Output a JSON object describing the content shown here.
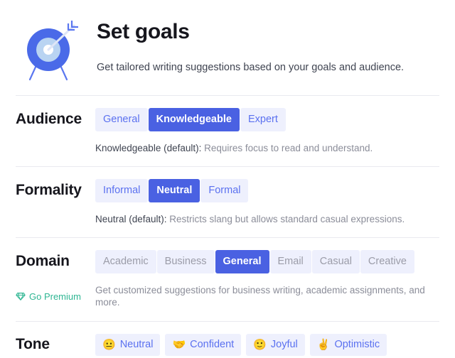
{
  "header": {
    "icon_name": "target-with-arrow-icon",
    "title": "Set goals",
    "subtitle": "Get tailored writing suggestions based on your goals and audience."
  },
  "colors": {
    "accent_selected": "#4a61e2",
    "chip_bg": "#eef0fd",
    "chip_text": "#5b71f0",
    "chip_disabled_text": "#9b9ca8",
    "premium_green": "#2fb693",
    "heading": "#16161d",
    "body_text": "#3f4451",
    "muted_text": "#8b8d99",
    "divider": "#e9eaef"
  },
  "sections": [
    {
      "id": "audience",
      "label": "Audience",
      "options": [
        {
          "label": "General",
          "selected": false,
          "disabled": false
        },
        {
          "label": "Knowledgeable",
          "selected": true,
          "disabled": false
        },
        {
          "label": "Expert",
          "selected": false,
          "disabled": false
        }
      ],
      "description_strong": "Knowledgeable (default):",
      "description_rest": " Requires focus to read and understand."
    },
    {
      "id": "formality",
      "label": "Formality",
      "options": [
        {
          "label": "Informal",
          "selected": false,
          "disabled": false
        },
        {
          "label": "Neutral",
          "selected": true,
          "disabled": false
        },
        {
          "label": "Formal",
          "selected": false,
          "disabled": false
        }
      ],
      "description_strong": "Neutral (default):",
      "description_rest": " Restricts slang but allows standard casual expressions."
    },
    {
      "id": "domain",
      "label": "Domain",
      "options": [
        {
          "label": "Academic",
          "selected": false,
          "disabled": true
        },
        {
          "label": "Business",
          "selected": false,
          "disabled": true
        },
        {
          "label": "General",
          "selected": true,
          "disabled": false
        },
        {
          "label": "Email",
          "selected": false,
          "disabled": true
        },
        {
          "label": "Casual",
          "selected": false,
          "disabled": true
        },
        {
          "label": "Creative",
          "selected": false,
          "disabled": true
        }
      ],
      "premium_label": "Go Premium",
      "premium_icon_name": "gem-icon",
      "description_rest": "Get customized suggestions for business writing, academic assignments, and more."
    },
    {
      "id": "tone",
      "label": "Tone",
      "options": [
        {
          "label": "Neutral",
          "emoji": "😐",
          "emoji_name": "neutral-face-emoji",
          "selected": false,
          "disabled": false
        },
        {
          "label": "Confident",
          "emoji": "🤝",
          "emoji_name": "handshake-emoji",
          "selected": false,
          "disabled": false
        },
        {
          "label": "Joyful",
          "emoji": "🙂",
          "emoji_name": "slightly-smiling-face-emoji",
          "selected": false,
          "disabled": false
        },
        {
          "label": "Optimistic",
          "emoji": "✌️",
          "emoji_name": "victory-hand-emoji",
          "selected": false,
          "disabled": false
        }
      ]
    }
  ]
}
